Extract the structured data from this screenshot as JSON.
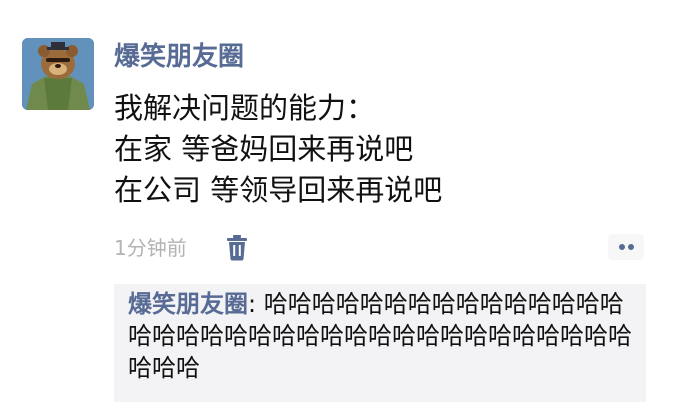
{
  "post": {
    "author": "爆笑朋友圈",
    "content_lines": [
      "我解决问题的能力：",
      "在家 等爸妈回来再说吧",
      "在公司 等领导回来再说吧"
    ],
    "time": "1分钟前",
    "avatar_icon": "cartoon-bear-avatar",
    "delete_icon": "trash-icon",
    "more_icon": "more-dots-icon",
    "colors": {
      "name": "#576b95",
      "text": "#111111",
      "time": "#b3b3b3",
      "comment_bg": "#f3f3f5"
    }
  },
  "comments": [
    {
      "author": "爆笑朋友圈",
      "separator": ": ",
      "text": "哈哈哈哈哈哈哈哈哈哈哈哈哈哈哈哈哈哈哈哈哈哈哈哈哈哈哈哈哈哈哈哈哈哈哈哈哈哈哈"
    }
  ]
}
